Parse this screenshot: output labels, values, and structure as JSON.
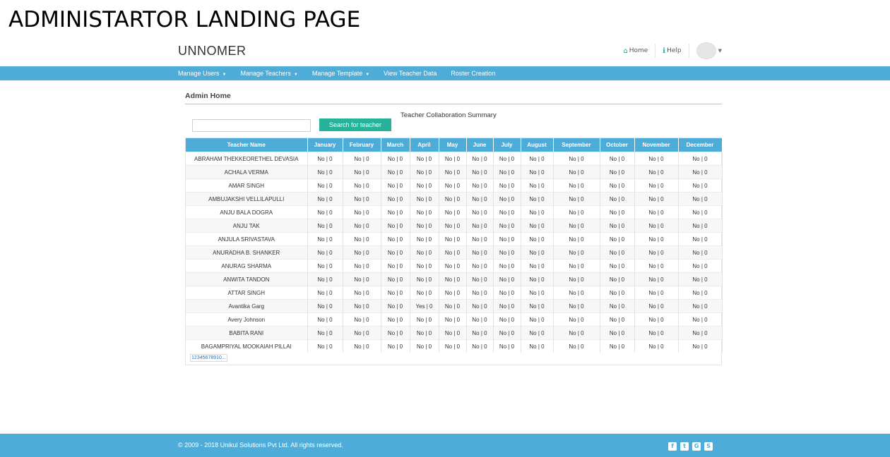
{
  "caption": "ADMINISTARTOR LANDING PAGE",
  "brand": "UNNOMER",
  "top_links": [
    {
      "label": "Home",
      "icon": "home-icon",
      "glyph": "⌂"
    },
    {
      "label": "Help",
      "icon": "info-icon",
      "glyph": "ℹ"
    }
  ],
  "nav": [
    {
      "label": "Manage Users",
      "dropdown": true
    },
    {
      "label": "Manage Teachers",
      "dropdown": true
    },
    {
      "label": "Manage Template",
      "dropdown": true
    },
    {
      "label": "View Teacher Data",
      "dropdown": false
    },
    {
      "label": "Roster Creation",
      "dropdown": false
    }
  ],
  "admin_home": "Admin Home",
  "summary_title": "Teacher Collaboration Summary",
  "search": {
    "placeholder": "",
    "button": "Search for teacher"
  },
  "table": {
    "columns": [
      "Teacher Name",
      "January",
      "February",
      "March",
      "April",
      "May",
      "June",
      "July",
      "August",
      "September",
      "October",
      "November",
      "December"
    ],
    "rows": [
      {
        "name": "ABRAHAM THEKKEORETHEL DEVASIA",
        "values": [
          "No | 0",
          "No | 0",
          "No | 0",
          "No | 0",
          "No | 0",
          "No | 0",
          "No | 0",
          "No | 0",
          "No | 0",
          "No | 0",
          "No | 0",
          "No | 0"
        ]
      },
      {
        "name": "ACHALA VERMA",
        "values": [
          "No | 0",
          "No | 0",
          "No | 0",
          "No | 0",
          "No | 0",
          "No | 0",
          "No | 0",
          "No | 0",
          "No | 0",
          "No | 0",
          "No | 0",
          "No | 0"
        ]
      },
      {
        "name": "AMAR SINGH",
        "values": [
          "No | 0",
          "No | 0",
          "No | 0",
          "No | 0",
          "No | 0",
          "No | 0",
          "No | 0",
          "No | 0",
          "No | 0",
          "No | 0",
          "No | 0",
          "No | 0"
        ]
      },
      {
        "name": "AMBUJAKSHI VELLILAPULLI",
        "values": [
          "No | 0",
          "No | 0",
          "No | 0",
          "No | 0",
          "No | 0",
          "No | 0",
          "No | 0",
          "No | 0",
          "No | 0",
          "No | 0",
          "No | 0",
          "No | 0"
        ]
      },
      {
        "name": "ANJU BALA DOGRA",
        "values": [
          "No | 0",
          "No | 0",
          "No | 0",
          "No | 0",
          "No | 0",
          "No | 0",
          "No | 0",
          "No | 0",
          "No | 0",
          "No | 0",
          "No | 0",
          "No | 0"
        ]
      },
      {
        "name": "ANJU TAK",
        "values": [
          "No | 0",
          "No | 0",
          "No | 0",
          "No | 0",
          "No | 0",
          "No | 0",
          "No | 0",
          "No | 0",
          "No | 0",
          "No | 0",
          "No | 0",
          "No | 0"
        ]
      },
      {
        "name": "ANJULA SRIVASTAVA",
        "values": [
          "No | 0",
          "No | 0",
          "No | 0",
          "No | 0",
          "No | 0",
          "No | 0",
          "No | 0",
          "No | 0",
          "No | 0",
          "No | 0",
          "No | 0",
          "No | 0"
        ]
      },
      {
        "name": "ANURADHA B. SHANKER",
        "values": [
          "No | 0",
          "No | 0",
          "No | 0",
          "No | 0",
          "No | 0",
          "No | 0",
          "No | 0",
          "No | 0",
          "No | 0",
          "No | 0",
          "No | 0",
          "No | 0"
        ]
      },
      {
        "name": "ANURAG SHARMA",
        "values": [
          "No | 0",
          "No | 0",
          "No | 0",
          "No | 0",
          "No | 0",
          "No | 0",
          "No | 0",
          "No | 0",
          "No | 0",
          "No | 0",
          "No | 0",
          "No | 0"
        ]
      },
      {
        "name": "ANWITA TANDON",
        "values": [
          "No | 0",
          "No | 0",
          "No | 0",
          "No | 0",
          "No | 0",
          "No | 0",
          "No | 0",
          "No | 0",
          "No | 0",
          "No | 0",
          "No | 0",
          "No | 0"
        ]
      },
      {
        "name": "ATTAR SINGH",
        "values": [
          "No | 0",
          "No | 0",
          "No | 0",
          "No | 0",
          "No | 0",
          "No | 0",
          "No | 0",
          "No | 0",
          "No | 0",
          "No | 0",
          "No | 0",
          "No | 0"
        ]
      },
      {
        "name": "Avantika Garg",
        "values": [
          "No | 0",
          "No | 0",
          "No | 0",
          "Yes | 0",
          "No | 0",
          "No | 0",
          "No | 0",
          "No | 0",
          "No | 0",
          "No | 0",
          "No | 0",
          "No | 0"
        ]
      },
      {
        "name": "Avery Johnson",
        "values": [
          "No | 0",
          "No | 0",
          "No | 0",
          "No | 0",
          "No | 0",
          "No | 0",
          "No | 0",
          "No | 0",
          "No | 0",
          "No | 0",
          "No | 0",
          "No | 0"
        ]
      },
      {
        "name": "BABITA RANI",
        "values": [
          "No | 0",
          "No | 0",
          "No | 0",
          "No | 0",
          "No | 0",
          "No | 0",
          "No | 0",
          "No | 0",
          "No | 0",
          "No | 0",
          "No | 0",
          "No | 0"
        ]
      },
      {
        "name": "BAGAMPRIYAL MOOKAIAH PILLAI",
        "values": [
          "No | 0",
          "No | 0",
          "No | 0",
          "No | 0",
          "No | 0",
          "No | 0",
          "No | 0",
          "No | 0",
          "No | 0",
          "No | 0",
          "No | 0",
          "No | 0"
        ]
      }
    ]
  },
  "pager": [
    "1",
    "2",
    "3",
    "4",
    "5",
    "6",
    "7",
    "8",
    "9",
    "10",
    "..."
  ],
  "footer": {
    "copyright": "© 2009 - 2018 Unikul Solutions Pvt Ltd. All rights reserved.",
    "social": [
      {
        "icon": "facebook-icon",
        "glyph": "f"
      },
      {
        "icon": "twitter-icon",
        "glyph": "t"
      },
      {
        "icon": "google-plus-icon",
        "glyph": "G"
      },
      {
        "icon": "skype-icon",
        "glyph": "S"
      }
    ]
  },
  "colors": {
    "accent": "#4eadd8",
    "button": "#26b39a",
    "icon": "#26a69a"
  }
}
